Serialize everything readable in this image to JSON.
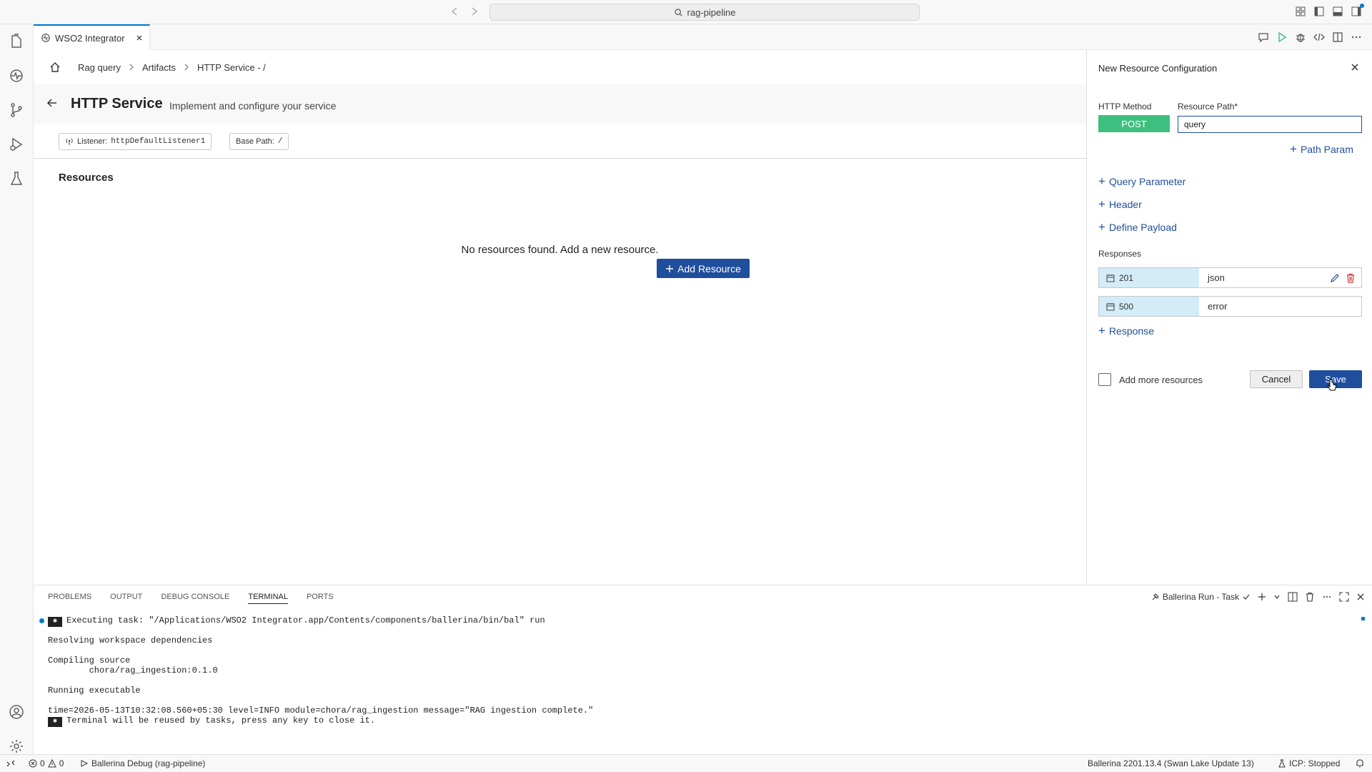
{
  "window": {
    "search": "rag-pipeline"
  },
  "tab": {
    "label": "WSO2 Integrator"
  },
  "breadcrumb": {
    "items": [
      "Rag query",
      "Artifacts",
      "HTTP Service - /"
    ]
  },
  "service": {
    "title": "HTTP Service",
    "subtitle": "Implement and configure your service",
    "listener_label": "Listener:",
    "listener_value": "httpDefaultListener1",
    "base_path_label": "Base Path:",
    "base_path_value": "/"
  },
  "resources": {
    "heading": "Resources",
    "empty_message": "No resources found. Add a new resource.",
    "add_label": "Add Resource"
  },
  "panel": {
    "title": "New Resource Configuration",
    "method_label": "HTTP Method",
    "method_value": "POST",
    "path_label": "Resource Path*",
    "path_value": "query",
    "path_param": "Path Param",
    "query_param": "Query Parameter",
    "header": "Header",
    "define_payload": "Define Payload",
    "responses_label": "Responses",
    "responses": [
      {
        "code": "201",
        "type": "json"
      },
      {
        "code": "500",
        "type": "error"
      }
    ],
    "add_response": "Response",
    "add_more": "Add more resources",
    "cancel": "Cancel",
    "save": "Save"
  },
  "bottom_panel": {
    "tabs": [
      "PROBLEMS",
      "OUTPUT",
      "DEBUG CONSOLE",
      "TERMINAL",
      "PORTS"
    ],
    "active_tab": "TERMINAL",
    "task_name": "Ballerina Run - Task",
    "terminal_lines": [
      "Executing task: \"/Applications/WSO2 Integrator.app/Contents/components/ballerina/bin/bal\" run",
      "Resolving workspace dependencies",
      "Compiling source",
      "        chora/rag_ingestion:0.1.0",
      "Running executable",
      "time=2026-05-13T10:32:08.560+05:30 level=INFO module=chora/rag_ingestion message=\"RAG ingestion complete.\"",
      "Terminal will be reused by tasks, press any key to close it."
    ]
  },
  "statusbar": {
    "errors": "0",
    "warnings": "0",
    "debug": "Ballerina Debug (rag-pipeline)",
    "version": "Ballerina 2201.13.4 (Swan Lake Update 13)",
    "icp": "ICP: Stopped"
  },
  "colors": {
    "accent": "#1f4e9c",
    "post_method": "#3fbf7f",
    "response_code_bg": "#d3ecf7",
    "delete": "#d13438"
  }
}
